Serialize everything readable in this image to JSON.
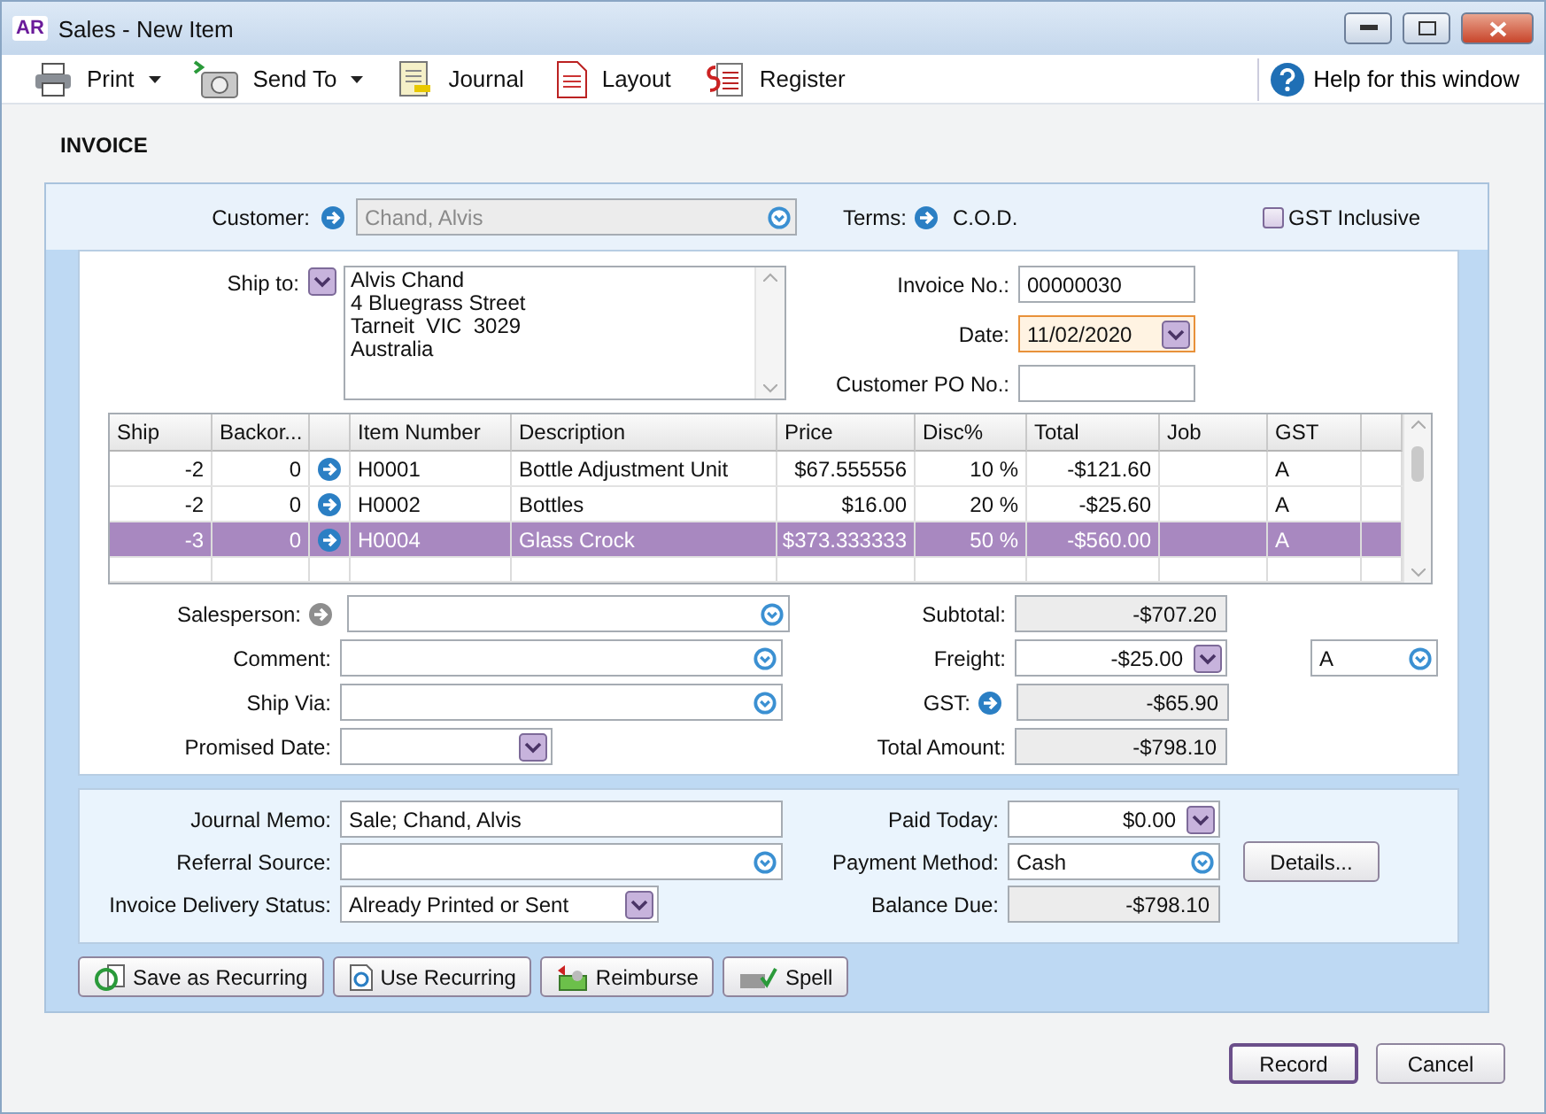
{
  "window": {
    "badge": "AR",
    "title": "Sales - New Item"
  },
  "toolbar": [
    {
      "label": "Print",
      "menu": true
    },
    {
      "label": "Send To",
      "menu": true
    },
    {
      "label": "Journal",
      "menu": false
    },
    {
      "label": "Layout",
      "menu": false
    },
    {
      "label": "Register",
      "menu": false
    }
  ],
  "help": "Help for this window",
  "heading": "INVOICE",
  "customer": {
    "label": "Customer:",
    "value": "Chand, Alvis",
    "disabled": true
  },
  "terms": {
    "label": "Terms:",
    "value": "C.O.D."
  },
  "gst_inclusive": {
    "label": "GST Inclusive",
    "checked": false
  },
  "ship_to": {
    "label": "Ship to:",
    "lines": [
      "Alvis Chand",
      "4 Bluegrass Street",
      "Tarneit  VIC  3029",
      "Australia"
    ]
  },
  "header_fields": [
    {
      "label": "Invoice No.:",
      "value": "00000030",
      "kind": "text",
      "focused": false
    },
    {
      "label": "Date:",
      "value": "11/02/2020",
      "kind": "date",
      "focused": true
    },
    {
      "label": "Customer PO No.:",
      "kind": "text",
      "focused": false
    }
  ],
  "table": {
    "columns": [
      "Ship",
      "Backor...",
      "Item Number",
      "Description",
      "Price",
      "Disc%",
      "Total",
      "Job",
      "GST"
    ],
    "rows": [
      {
        "ship": "-2",
        "backorder": "0",
        "item_number": "H0001",
        "description": "Bottle Adjustment Unit",
        "price": "$67.555556",
        "disc": "10 %",
        "total": "-$121.60",
        "gst": "A",
        "selected": false
      },
      {
        "ship": "-2",
        "backorder": "0",
        "item_number": "H0002",
        "description": "Bottles",
        "price": "$16.00",
        "disc": "20 %",
        "total": "-$25.60",
        "gst": "A",
        "selected": false
      },
      {
        "ship": "-3",
        "backorder": "0",
        "item_number": "H0004",
        "description": "Glass Crock",
        "price": "$373.333333",
        "disc": "50 %",
        "total": "-$560.00",
        "gst": "A",
        "selected": true
      }
    ]
  },
  "details_fields": [
    {
      "label": "Salesperson:",
      "kind": "combo",
      "arrow_enabled": false
    },
    {
      "label": "Comment:",
      "kind": "combo"
    },
    {
      "label": "Ship Via:",
      "kind": "combo"
    },
    {
      "label": "Promised Date:",
      "kind": "date"
    }
  ],
  "totals": [
    {
      "label": "Subtotal:",
      "value": "-$707.20",
      "kind": "readonly"
    },
    {
      "label": "Freight:",
      "value": "-$25.00",
      "kind": "dropdown"
    },
    {
      "label": "GST:",
      "value": "-$65.90",
      "kind": "readonly",
      "arrow_enabled": true
    },
    {
      "label": "Total Amount:",
      "value": "-$798.10",
      "kind": "readonly"
    }
  ],
  "freight_tax_code": "A",
  "payment_left": [
    {
      "label": "Journal Memo:",
      "value": "Sale; Chand, Alvis",
      "kind": "text"
    },
    {
      "label": "Referral Source:",
      "kind": "combo"
    },
    {
      "label": "Invoice Delivery Status:",
      "value": "Already Printed or Sent",
      "kind": "dropdown"
    }
  ],
  "payment_right": [
    {
      "label": "Paid Today:",
      "value": "$0.00",
      "kind": "dropdown"
    },
    {
      "label": "Payment Method:",
      "value": "Cash",
      "kind": "combo"
    },
    {
      "label": "Balance Due:",
      "value": "-$798.10",
      "kind": "readonly"
    }
  ],
  "details_button": "Details...",
  "actions": [
    "Save as Recurring",
    "Use Recurring",
    "Reimburse",
    "Spell"
  ],
  "footer": [
    {
      "label": "Record",
      "default": true
    },
    {
      "label": "Cancel",
      "default": false
    }
  ]
}
